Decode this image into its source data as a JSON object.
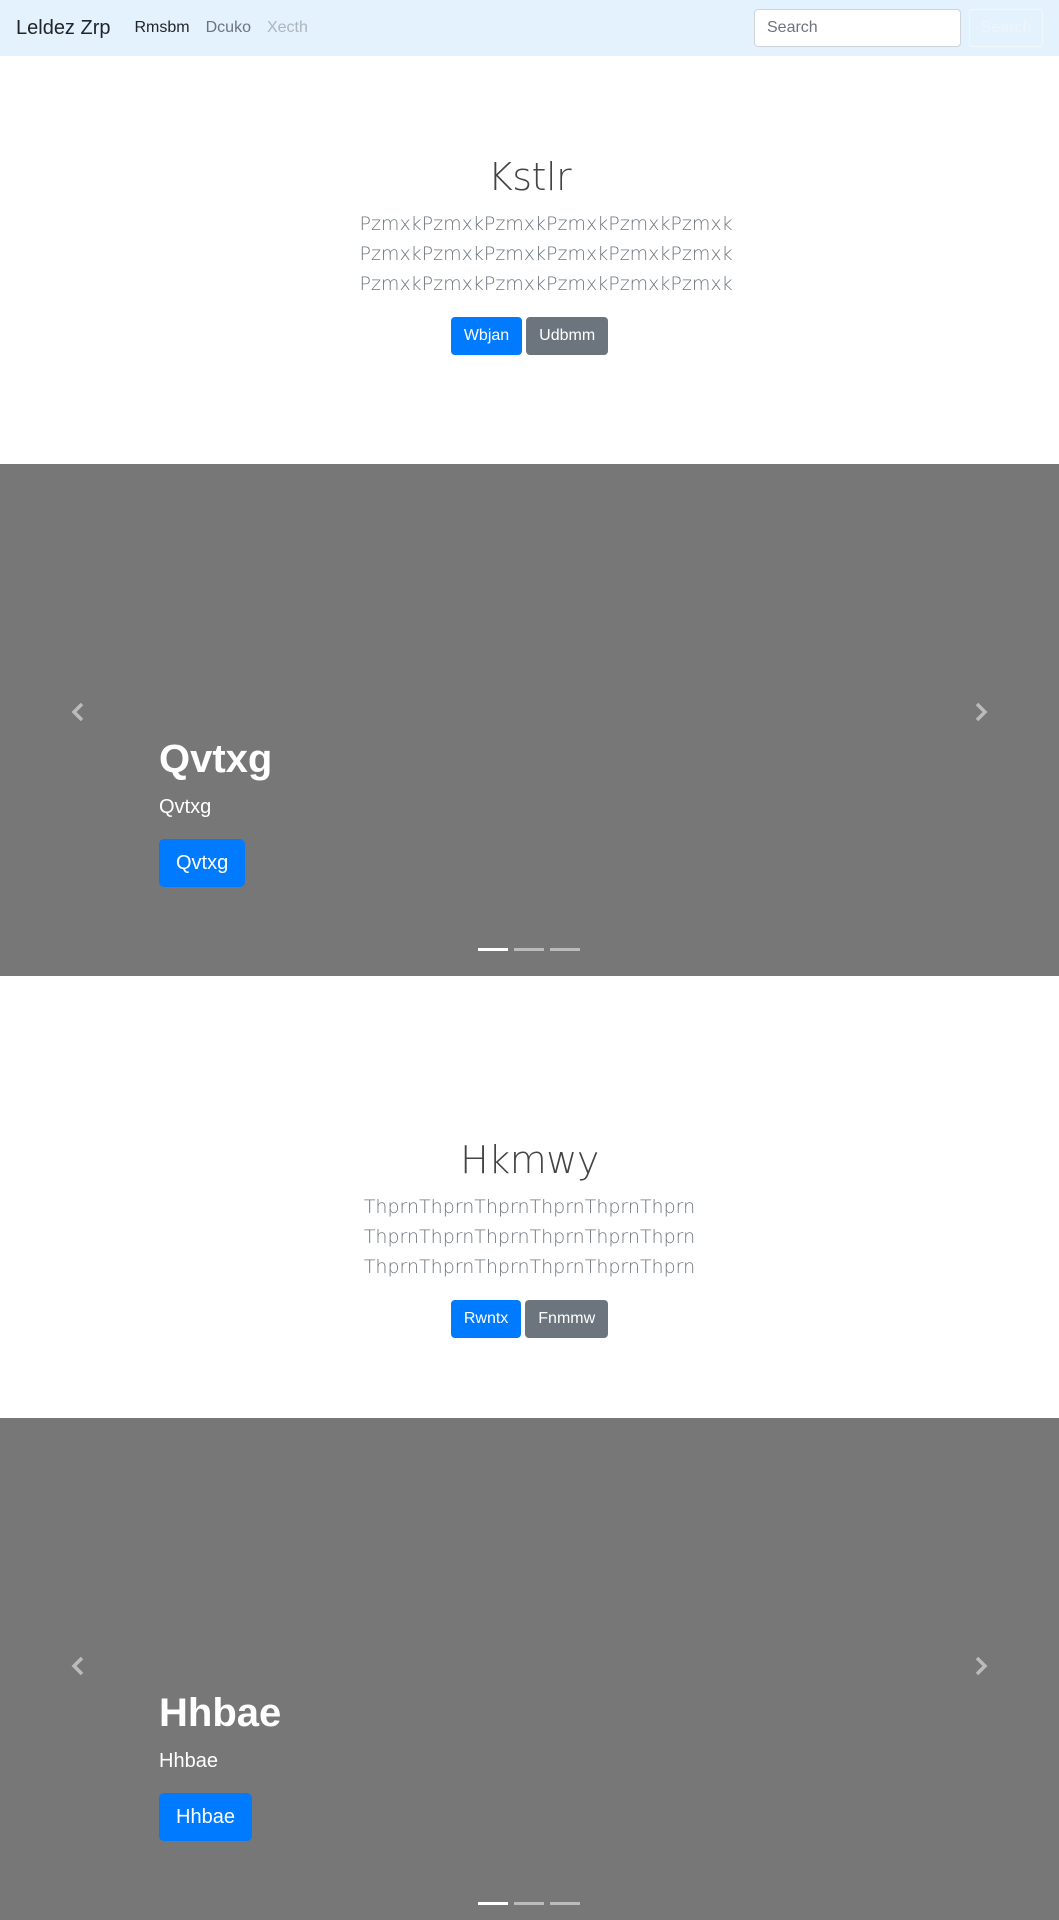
{
  "navbar": {
    "brand": "Leldez Zrp",
    "links": [
      {
        "label": "Rmsbm",
        "state": "active"
      },
      {
        "label": "Dcuko",
        "state": "normal"
      },
      {
        "label": "Xecth",
        "state": "disabled"
      }
    ],
    "search_placeholder": "Search",
    "search_button": "Search"
  },
  "section1": {
    "title": "Kstlr",
    "lines": [
      "PzmxkPzmxkPzmxkPzmxkPzmxkPzmxk",
      "PzmxkPzmxkPzmxkPzmxkPzmxkPzmxk",
      "PzmxkPzmxkPzmxkPzmxkPzmxkPzmxk"
    ],
    "primary_button": "Wbjan",
    "secondary_button": "Udbmm"
  },
  "carousel1": {
    "heading": "Qvtxg",
    "text": "Qvtxg",
    "button": "Qvtxg",
    "indicator_count": 3,
    "active_indicator": 0
  },
  "section2": {
    "title": "Hkmwy",
    "lines": [
      "ThprnThprnThprnThprnThprnThprn ThprnThprnThprnThprnThprnThprn",
      "ThprnThprnThprnThprnThprnThprn"
    ],
    "primary_button": "Rwntx",
    "secondary_button": "Fnmmw"
  },
  "carousel2": {
    "heading": "Hhbae",
    "text": "Hhbae",
    "button": "Hhbae",
    "indicator_count": 3,
    "active_indicator": 0
  },
  "colors": {
    "navbar_bg": "#e3f2fd",
    "carousel_bg": "#777777",
    "primary": "#007bff",
    "secondary": "#6c757d"
  }
}
